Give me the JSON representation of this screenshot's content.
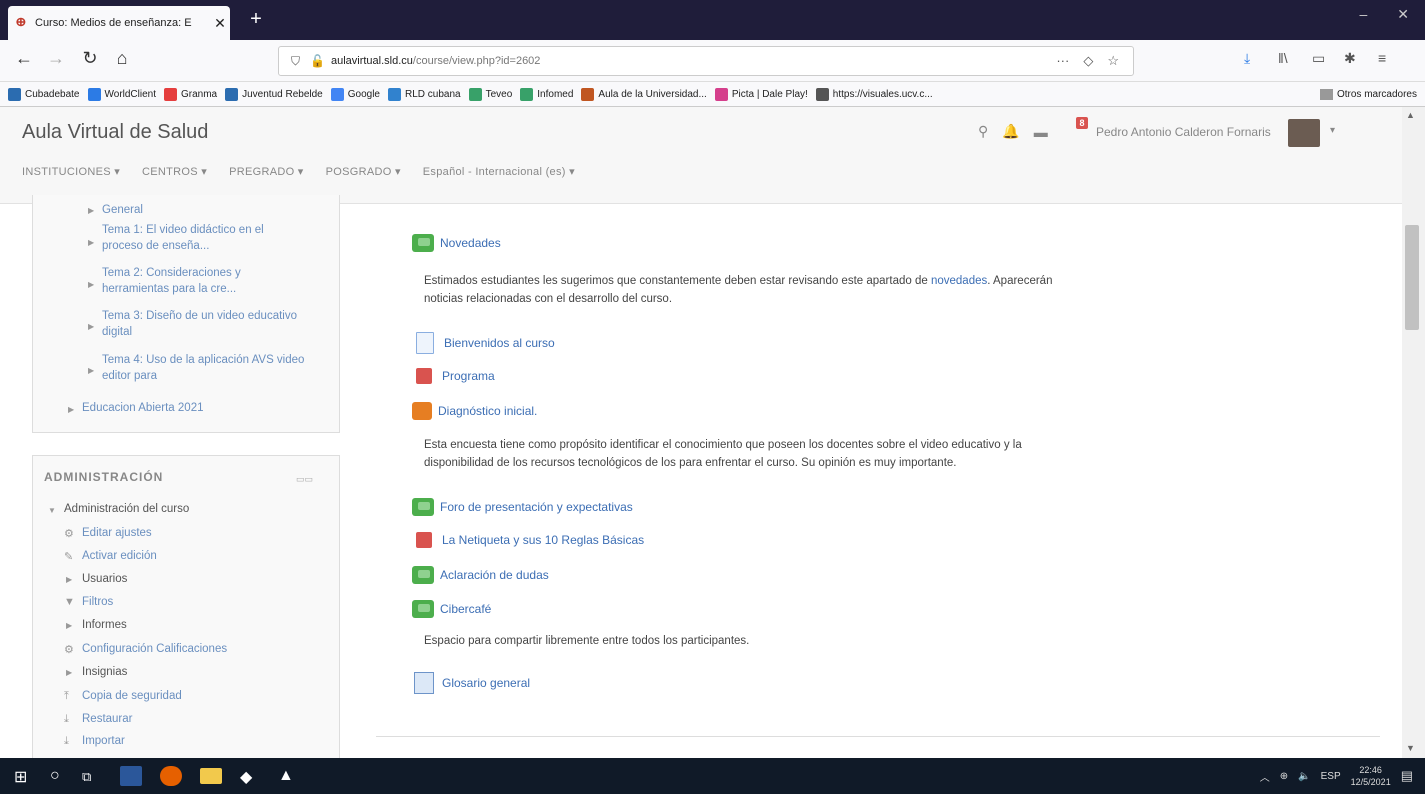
{
  "browser": {
    "tab_title": "Curso: Medios de enseñanza: E",
    "url_domain": "aulavirtual.sld.cu",
    "url_path": "/course/view.php?id=2602",
    "url_icons_more": "···",
    "bookmarks": [
      {
        "label": "Cubadebate",
        "color": "#2b6cb0"
      },
      {
        "label": "WorldClient",
        "color": "#2c7be5"
      },
      {
        "label": "Granma",
        "color": "#e53e3e"
      },
      {
        "label": "Juventud Rebelde",
        "color": "#2b6cb0"
      },
      {
        "label": "Google",
        "color": "#4285f4"
      },
      {
        "label": "RLD cubana",
        "color": "#3182ce"
      },
      {
        "label": "Teveo",
        "color": "#38a169"
      },
      {
        "label": "Infomed",
        "color": "#38a169"
      },
      {
        "label": "Aula de la Universidad...",
        "color": "#c05621"
      },
      {
        "label": "Picta | Dale Play!",
        "color": "#d53f8c"
      },
      {
        "label": "https://visuales.ucv.c...",
        "color": "#555555"
      }
    ],
    "other_bookmarks": "Otros marcadores"
  },
  "header": {
    "site_name": "Aula Virtual de Salud",
    "notification_count": "8",
    "user_name": "Pedro Antonio Calderon Fornaris",
    "menu": [
      "INSTITUCIONES ▾",
      "CENTROS ▾",
      "PREGRADO ▾",
      "POSGRADO ▾",
      "Español - Internacional (es) ▾"
    ]
  },
  "nav_block": {
    "items": [
      "General",
      "Tema 1: El video didáctico en el proceso de enseña...",
      "Tema 2: Consideraciones y herramientas para la cre...",
      "Tema 3: Diseño de un video educativo digital",
      "Tema 4: Uso de la aplicación AVS video editor para",
      "Educacion Abierta 2021"
    ]
  },
  "admin_block": {
    "title": "ADMINISTRACIÓN",
    "course_admin": "Administración del curso",
    "items": [
      "Editar ajustes",
      "Activar edición",
      "Usuarios",
      "Filtros",
      "Informes",
      "Configuración Calificaciones",
      "Insignias",
      "Copia de seguridad",
      "Restaurar",
      "Importar"
    ]
  },
  "content": {
    "novedades": "Novedades",
    "novedades_desc_1": "Estimados estudiantes les sugerimos que constantemente deben estar revisando este apartado de",
    "novedades_link": "novedades",
    "novedades_desc_2": ". Aparecerán",
    "novedades_desc_3": "noticias relacionadas con el desarrollo del curso.",
    "bienvenidos": "Bienvenidos al curso",
    "programa": "Programa",
    "diagnostico": "Diagnóstico inicial.",
    "diagnostico_desc_1": "Esta encuesta tiene como propósito identificar el conocimiento que poseen los docentes sobre el video educativo y la",
    "diagnostico_desc_2": "disponibilidad de los recursos tecnológicos de los para enfrentar el curso. Su opinión es muy importante.",
    "foro": "Foro de presentación y expectativas",
    "netiqueta": "La Netiqueta y sus 10 Reglas Básicas",
    "aclaracion": "Aclaración de dudas",
    "cibercafe": "Cibercafé",
    "cibercafe_desc": "Espacio para compartir libremente entre todos los participantes.",
    "glosario": "Glosario general"
  },
  "taskbar": {
    "lang": "ESP",
    "time": "22:46",
    "date": "12/5/2021"
  }
}
